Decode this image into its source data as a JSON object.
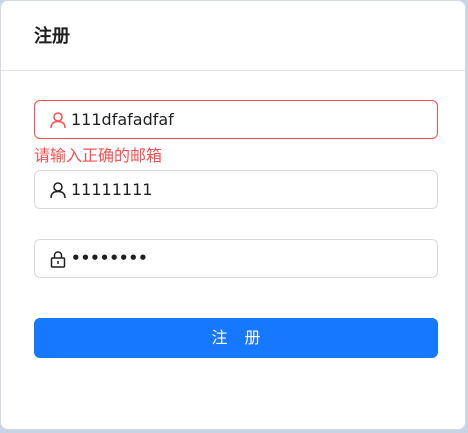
{
  "form": {
    "title": "注册",
    "email": {
      "value": "111dfafadfaf",
      "error": "请输入正确的邮箱"
    },
    "username": {
      "value": "11111111"
    },
    "password": {
      "value": "••••••••"
    },
    "submit_label": "注 册"
  },
  "colors": {
    "primary": "#1677ff",
    "error": "#ff4d4f",
    "border": "#d9d9d9"
  },
  "icons": {
    "email": "user-icon",
    "username": "user-icon",
    "password": "lock-icon"
  }
}
